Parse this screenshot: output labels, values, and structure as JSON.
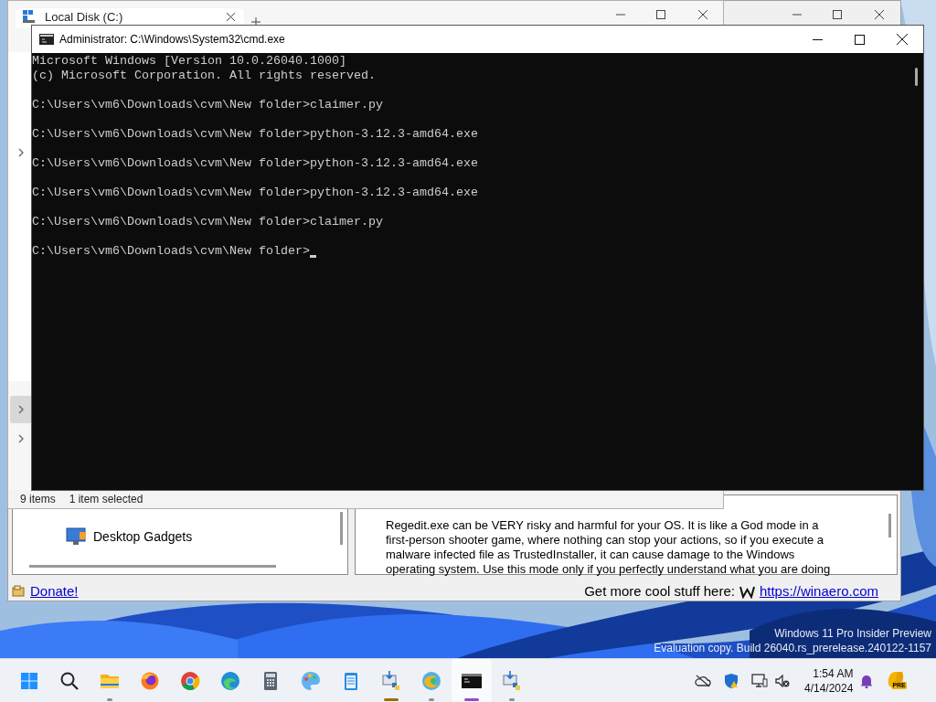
{
  "explorer": {
    "tab_title": "Local Disk (C:)",
    "nav_chevrons": [
      {
        "selected": false
      },
      {
        "selected": true
      },
      {
        "selected": false
      }
    ],
    "status_items": "9 items",
    "status_selected": "1 item selected"
  },
  "winaero": {
    "tree_items": [
      "Desktop Gadgets"
    ],
    "warning_lines": [
      "Regedit.exe can be VERY risky and harmful for your OS. It is like a God mode in a",
      "first-person shooter game, where nothing can stop your actions, so if you execute a",
      "malware infected file as TrustedInstaller, it can cause damage to the Windows",
      "operating system. Use this mode only if you perfectly understand what you are doing"
    ],
    "donate": "Donate!",
    "promo": "Get more cool stuff here:",
    "link": "https://winaero.com"
  },
  "cmd": {
    "title": "Administrator: C:\\Windows\\System32\\cmd.exe",
    "cursor": true,
    "blocks": [
      [
        "Microsoft Windows [Version 10.0.26040.1000]",
        "(c) Microsoft Corporation. All rights reserved."
      ],
      [
        "C:\\Users\\vm6\\Downloads\\cvm\\New folder>claimer.py"
      ],
      [
        "C:\\Users\\vm6\\Downloads\\cvm\\New folder>python-3.12.3-amd64.exe"
      ],
      [
        "C:\\Users\\vm6\\Downloads\\cvm\\New folder>python-3.12.3-amd64.exe"
      ],
      [
        "C:\\Users\\vm6\\Downloads\\cvm\\New folder>python-3.12.3-amd64.exe"
      ],
      [
        "C:\\Users\\vm6\\Downloads\\cvm\\New folder>claimer.py"
      ],
      [
        "C:\\Users\\vm6\\Downloads\\cvm\\New folder>"
      ]
    ]
  },
  "desktop": {
    "watermark": [
      "Windows 11 Pro Insider Preview",
      "Evaluation copy. Build 26040.rs_prerelease.240122-1157"
    ]
  },
  "taskbar": {
    "apps": [
      {
        "kind": "start",
        "running": false,
        "selected": false,
        "flashing": false
      },
      {
        "kind": "search",
        "running": false,
        "selected": false,
        "flashing": false
      },
      {
        "kind": "folder",
        "running": true,
        "selected": false,
        "flashing": false
      },
      {
        "kind": "firefox",
        "running": false,
        "selected": false,
        "flashing": false
      },
      {
        "kind": "chrome",
        "running": false,
        "selected": false,
        "flashing": false
      },
      {
        "kind": "edge",
        "running": false,
        "selected": false,
        "flashing": false
      },
      {
        "kind": "calculator",
        "running": false,
        "selected": false,
        "flashing": false
      },
      {
        "kind": "paint",
        "running": false,
        "selected": false,
        "flashing": false
      },
      {
        "kind": "notepad",
        "running": false,
        "selected": false,
        "flashing": false
      },
      {
        "kind": "installer",
        "running": true,
        "selected": false,
        "flashing": true
      },
      {
        "kind": "swirl",
        "running": true,
        "selected": false,
        "flashing": false
      },
      {
        "kind": "terminal",
        "running": true,
        "selected": true,
        "flashing": false
      },
      {
        "kind": "installer",
        "running": true,
        "selected": false,
        "flashing": false
      }
    ],
    "time": "1:54 AM",
    "date": "4/14/2024",
    "badge": "PRE"
  }
}
